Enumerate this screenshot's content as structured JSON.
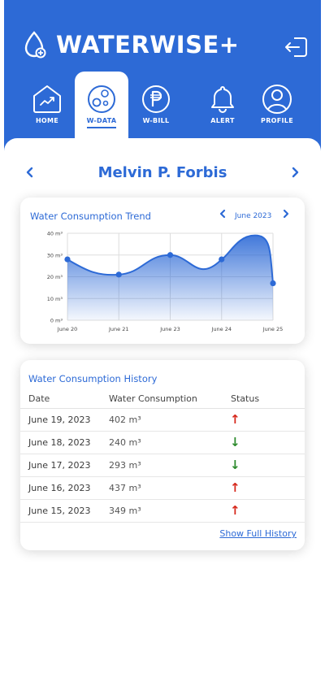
{
  "app": {
    "brand": "WATERWISE+",
    "colors": {
      "primary": "#2d6ad6",
      "up": "#d6281c",
      "down": "#2c8a2c"
    }
  },
  "header": {
    "logout_icon": "logout-icon"
  },
  "nav": {
    "items": [
      {
        "label": "HOME",
        "icon": "home-chart-icon",
        "active": false
      },
      {
        "label": "W-DATA",
        "icon": "water-data-icon",
        "active": true
      },
      {
        "label": "W-BILL",
        "icon": "peso-icon",
        "active": false
      },
      {
        "label": "ALERT",
        "icon": "bell-icon",
        "active": false
      },
      {
        "label": "PROFILE",
        "icon": "user-icon",
        "active": false
      }
    ]
  },
  "person": {
    "name": "Melvin P. Forbis",
    "prev_icon": "chevron-left-icon",
    "next_icon": "chevron-right-icon"
  },
  "trend": {
    "title": "Water Consumption Trend",
    "month": "June 2023"
  },
  "chart_data": {
    "type": "area",
    "title": "Water Consumption Trend",
    "categories": [
      "June 20",
      "June 21",
      "June 23",
      "June 24",
      "June 25"
    ],
    "x": [
      0,
      1,
      2,
      3,
      4
    ],
    "points": [
      {
        "x": 0,
        "y": 28
      },
      {
        "x": 1,
        "y": 21
      },
      {
        "x": 2,
        "y": 30
      },
      {
        "x": 3,
        "y": 28
      },
      {
        "x": 4,
        "y": 17
      }
    ],
    "peak": {
      "x": 3.65,
      "y": 39
    },
    "y_ticks": [
      "0 m³",
      "10 m³",
      "20 m³",
      "30 m³",
      "40 m³"
    ],
    "ylim": [
      0,
      40
    ],
    "grid": true,
    "color": "#2d6ad6"
  },
  "history": {
    "title": "Water Consumption History",
    "columns": [
      "Date",
      "Water Consumption",
      "Status"
    ],
    "rows": [
      {
        "date": "June 19, 2023",
        "consumption": "402 m³",
        "status": "up"
      },
      {
        "date": "June 18, 2023",
        "consumption": "240 m³",
        "status": "down"
      },
      {
        "date": "June 17, 2023",
        "consumption": "293 m³",
        "status": "down"
      },
      {
        "date": "June 16, 2023",
        "consumption": "437 m³",
        "status": "up"
      },
      {
        "date": "June 15, 2023",
        "consumption": "349 m³",
        "status": "up"
      }
    ],
    "show_full": "Show Full History",
    "arrow_up": "↑",
    "arrow_down": "↓"
  }
}
